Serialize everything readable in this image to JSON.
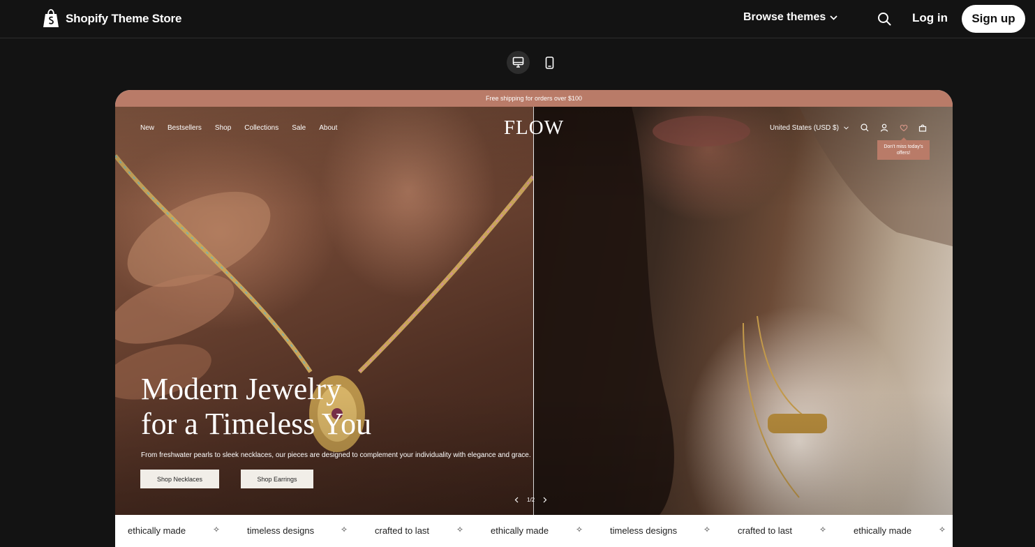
{
  "header": {
    "brand": "Shopify Theme Store",
    "browse_label": "Browse themes",
    "login_label": "Log in",
    "signup_label": "Sign up"
  },
  "device_switch": {
    "desktop_icon": "desktop-icon",
    "mobile_icon": "mobile-icon",
    "active": "desktop"
  },
  "store": {
    "announcement": "Free shipping for orders over $100",
    "nav": [
      "New",
      "Bestsellers",
      "Shop",
      "Collections",
      "Sale",
      "About"
    ],
    "logo": "FLOW",
    "currency": "United States (USD $)",
    "tooltip": "Don't miss today's offers!",
    "hero": {
      "heading_line1": "Modern Jewelry",
      "heading_line2": "for a Timeless You",
      "subtext": "From freshwater pearls to sleek necklaces, our pieces are designed to complement your individuality with elegance and grace.",
      "button1": "Shop Necklaces",
      "button2": "Shop Earrings",
      "slide_counter": "1/2"
    },
    "marquee": [
      "ethically made",
      "timeless designs",
      "crafted to last",
      "ethically made",
      "timeless designs",
      "crafted to last",
      "ethically made"
    ],
    "marquee_separator": "✧"
  },
  "colors": {
    "page_bg": "#131313",
    "accent": "#b97b68",
    "button_bg": "#f1eee8"
  }
}
